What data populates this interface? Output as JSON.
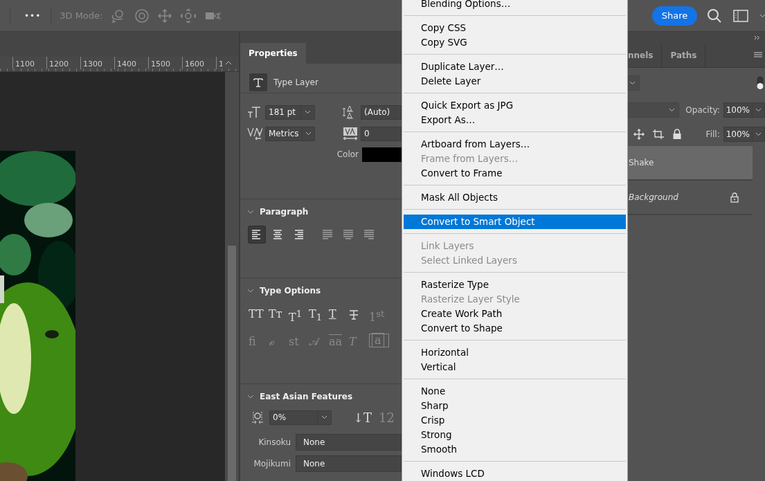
{
  "toolbar": {
    "more": "•••",
    "mode_label": "3D Mode:",
    "mode_disabled": true,
    "share": "Share"
  },
  "ruler": {
    "labels": [
      "1100",
      "1200",
      "1300",
      "1400",
      "1500",
      "1600",
      "1"
    ]
  },
  "properties": {
    "tab": "Properties",
    "layer_kind": "Type Layer",
    "size": "181 pt",
    "leading": "(Auto)",
    "kerning": "Metrics",
    "tracking": "0",
    "color_label": "Color",
    "paragraph": {
      "title": "Paragraph",
      "expanded": true,
      "alignments": [
        {
          "kind": "left",
          "selected": true
        },
        {
          "kind": "center",
          "selected": false
        },
        {
          "kind": "right",
          "selected": false
        },
        {
          "kind": "justify-left",
          "selected": false
        },
        {
          "kind": "justify-center",
          "selected": false
        },
        {
          "kind": "justify-right",
          "selected": false
        }
      ]
    },
    "type_options": {
      "title": "Type Options",
      "expanded": true,
      "buttons": [
        {
          "glyph": "TT",
          "kind": "plain",
          "disabled": false
        },
        {
          "glyph": "Tᴛ",
          "kind": "plain",
          "disabled": false
        },
        {
          "glyph": "T$^{1}$",
          "kind": "plain",
          "disabled": false
        },
        {
          "glyph": "T$_{1}$",
          "kind": "plain",
          "disabled": false
        },
        {
          "glyph": "T",
          "kind": "underline",
          "disabled": false
        },
        {
          "kind": "strike",
          "disabled": false
        },
        {
          "glyph": "1$^{st}$",
          "kind": "plain",
          "disabled": true
        },
        {
          "glyph": "fi",
          "kind": "plain",
          "disabled": true
        },
        {
          "glyph": "ℴ",
          "kind": "italic",
          "disabled": true
        },
        {
          "glyph": "st",
          "kind": "plain",
          "disabled": true
        },
        {
          "glyph": "𝒜",
          "kind": "plain",
          "disabled": true
        },
        {
          "glyph": "aa",
          "kind": "overline",
          "disabled": true
        },
        {
          "glyph": "T",
          "kind": "italic",
          "disabled": true
        },
        {
          "glyph": "a",
          "kind": "boxed",
          "disabled": true
        }
      ]
    },
    "east_asian": {
      "title": "East Asian Features",
      "expanded": true,
      "tsume": "0%",
      "tools": [
        {
          "glyph": "↓T",
          "disabled": false
        },
        {
          "glyph": "12",
          "disabled": true
        }
      ],
      "kinsoku_label": "Kinsoku",
      "kinsoku": "None",
      "mojikumi_label": "Mojikumi",
      "mojikumi": "None"
    }
  },
  "menu": {
    "groups": [
      [
        {
          "label": "Blending Options…",
          "disabled": false,
          "selected": false
        }
      ],
      [
        {
          "label": "Copy CSS",
          "disabled": false,
          "selected": false
        },
        {
          "label": "Copy SVG",
          "disabled": false,
          "selected": false
        }
      ],
      [
        {
          "label": "Duplicate Layer…",
          "disabled": false,
          "selected": false
        },
        {
          "label": "Delete Layer",
          "disabled": false,
          "selected": false
        }
      ],
      [
        {
          "label": "Quick Export as JPG",
          "disabled": false,
          "selected": false
        },
        {
          "label": "Export As…",
          "disabled": false,
          "selected": false
        }
      ],
      [
        {
          "label": "Artboard from Layers…",
          "disabled": false,
          "selected": false
        },
        {
          "label": "Frame from Layers…",
          "disabled": true,
          "selected": false
        },
        {
          "label": "Convert to Frame",
          "disabled": false,
          "selected": false
        }
      ],
      [
        {
          "label": "Mask All Objects",
          "disabled": false,
          "selected": false
        }
      ],
      [
        {
          "label": "Convert to Smart Object",
          "disabled": false,
          "selected": true
        }
      ],
      [
        {
          "label": "Link Layers",
          "disabled": true,
          "selected": false
        },
        {
          "label": "Select Linked Layers",
          "disabled": true,
          "selected": false
        }
      ],
      [
        {
          "label": "Rasterize Type",
          "disabled": false,
          "selected": false
        },
        {
          "label": "Rasterize Layer Style",
          "disabled": true,
          "selected": false
        },
        {
          "label": "Create Work Path",
          "disabled": false,
          "selected": false
        },
        {
          "label": "Convert to Shape",
          "disabled": false,
          "selected": false
        }
      ],
      [
        {
          "label": "Horizontal",
          "disabled": false,
          "selected": false
        },
        {
          "label": "Vertical",
          "disabled": false,
          "selected": false
        }
      ],
      [
        {
          "label": "None",
          "disabled": false,
          "selected": false
        },
        {
          "label": "Sharp",
          "disabled": false,
          "selected": false
        },
        {
          "label": "Crisp",
          "disabled": false,
          "selected": false
        },
        {
          "label": "Strong",
          "disabled": false,
          "selected": false
        },
        {
          "label": "Smooth",
          "disabled": false,
          "selected": false
        }
      ],
      [
        {
          "label": "Windows LCD",
          "disabled": false,
          "selected": false
        }
      ]
    ]
  },
  "layers_panel": {
    "tabs": [
      {
        "label": "nnels",
        "selected": false
      },
      {
        "label": "Paths",
        "selected": false
      }
    ],
    "opacity_label": "Opacity:",
    "opacity": "100%",
    "fill_label": "Fill:",
    "fill": "100%",
    "layers": [
      {
        "name": "Shake",
        "kind": "text",
        "selected": true,
        "locked": false
      },
      {
        "name": "Background",
        "kind": "background",
        "selected": false,
        "locked": true
      }
    ]
  }
}
